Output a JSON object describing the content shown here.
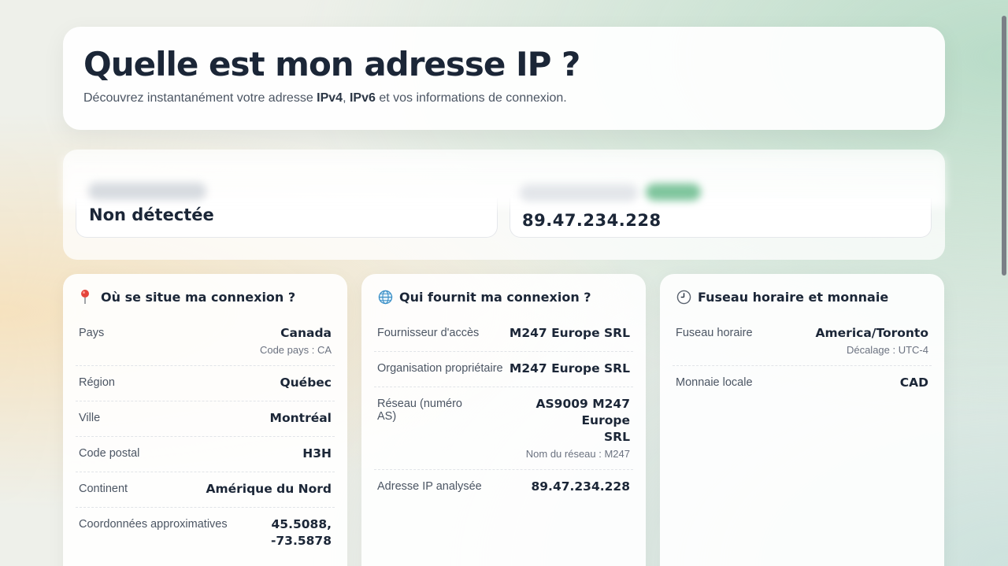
{
  "hero": {
    "title": "Quelle est mon adresse IP ?",
    "subtitle_pre": "Découvrez instantanément votre adresse ",
    "ipv4": "IPv4",
    "comma": ", ",
    "ipv6": "IPv6",
    "subtitle_post": " et vos informations de connexion."
  },
  "ip": {
    "ipv6_value": "Non détectée",
    "ipv4_value": "89.47.234.228"
  },
  "location": {
    "title": "Où se situe ma connexion ?",
    "icon": "pin-icon",
    "rows": [
      {
        "label": "Pays",
        "value": "Canada",
        "sub": "Code pays : CA"
      },
      {
        "label": "Région",
        "value": "Québec"
      },
      {
        "label": "Ville",
        "value": "Montréal"
      },
      {
        "label": "Code postal",
        "value": "H3H"
      },
      {
        "label": "Continent",
        "value": "Amérique du Nord"
      },
      {
        "label": "Coordonnées approximatives",
        "value": "45.5088,",
        "value2": "-73.5878"
      }
    ]
  },
  "provider": {
    "title": "Qui fournit ma connexion ?",
    "icon": "globe-icon",
    "rows": [
      {
        "label": "Fournisseur d'accès",
        "value": "M247 Europe SRL"
      },
      {
        "label": "Organisation propriétaire",
        "value": "M247 Europe SRL"
      },
      {
        "label": "Réseau (numéro AS)",
        "value": "AS9009 M247 Europe",
        "value2": "SRL",
        "sub": "Nom du réseau : M247"
      },
      {
        "label": "Adresse IP analysée",
        "value": "89.47.234.228"
      }
    ]
  },
  "timezone": {
    "title": "Fuseau horaire et monnaie",
    "icon": "clock-icon",
    "rows": [
      {
        "label": "Fuseau horaire",
        "value": "America/Toronto",
        "sub": "Décalage : UTC-4"
      },
      {
        "label": "Monnaie locale",
        "value": "CAD"
      }
    ]
  },
  "colors": {
    "text_dark": "#1b2637",
    "accent_green": "#7fc59d"
  }
}
